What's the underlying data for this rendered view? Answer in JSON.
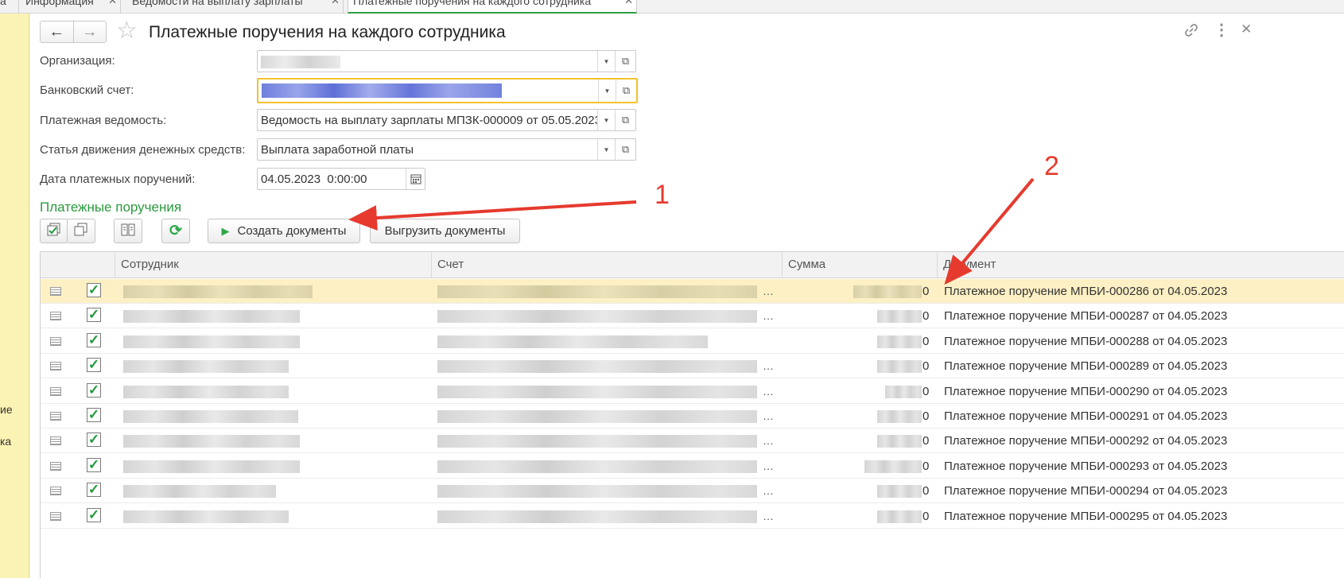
{
  "tabs": [
    {
      "label": "а"
    },
    {
      "label": "Информация"
    },
    {
      "label": "Ведомости на выплату зарплаты"
    },
    {
      "label": "Платежные поручения на каждого сотрудника"
    }
  ],
  "left_panel": {
    "fragments": [
      "ие",
      "ка"
    ]
  },
  "header": {
    "title": "Платежные поручения на каждого сотрудника",
    "back_icon": "arrow-left-icon",
    "forward_icon": "arrow-right-icon",
    "favorite_icon": "star-icon",
    "link_icon": "link-icon",
    "more_icon": "more-vertical-icon",
    "close_icon": "close-icon"
  },
  "form": {
    "organization_label": "Организация:",
    "bank_account_label": "Банковский счет:",
    "statement_label": "Платежная ведомость:",
    "statement_value": "Ведомость на выплату зарплаты МПЗК-000009 от 05.05.2023",
    "cashflow_label": "Статья движения денежных средств:",
    "cashflow_value": "Выплата заработной платы",
    "date_label": "Дата платежных поручений:",
    "date_value": "04.05.2023  0:00:00"
  },
  "section_title": "Платежные поручения",
  "toolbar": {
    "create_label": "Создать документы",
    "export_label": "Выгрузить документы"
  },
  "table": {
    "columns": [
      "Сотрудник",
      "Счет",
      "Сумма",
      "Документ"
    ],
    "rows": [
      {
        "sum_tail": "0",
        "document": "Платежное поручение МПБИ-000286 от 04.05.2023"
      },
      {
        "sum_tail": "0",
        "document": "Платежное поручение МПБИ-000287 от 04.05.2023"
      },
      {
        "sum_tail": "0",
        "document": "Платежное поручение МПБИ-000288 от 04.05.2023"
      },
      {
        "sum_tail": "0",
        "document": "Платежное поручение МПБИ-000289 от 04.05.2023"
      },
      {
        "sum_tail": "0",
        "document": "Платежное поручение МПБИ-000290 от 04.05.2023"
      },
      {
        "sum_tail": "0",
        "document": "Платежное поручение МПБИ-000291 от 04.05.2023"
      },
      {
        "sum_tail": "0",
        "document": "Платежное поручение МПБИ-000292 от 04.05.2023"
      },
      {
        "sum_tail": "0",
        "document": "Платежное поручение МПБИ-000293 от 04.05.2023"
      },
      {
        "sum_tail": "0",
        "document": "Платежное поручение МПБИ-000294 от 04.05.2023"
      },
      {
        "sum_tail": "0",
        "document": "Платежное поручение МПБИ-000295 от 04.05.2023"
      }
    ]
  },
  "annotations": {
    "label_1": "1",
    "label_2": "2"
  },
  "colors": {
    "section_green": "#2c9a3f",
    "focus_border": "#f2c230",
    "selected_row": "#fcf0c4",
    "arrow_red": "#e63a2e",
    "left_panel": "#fbf3b3"
  }
}
